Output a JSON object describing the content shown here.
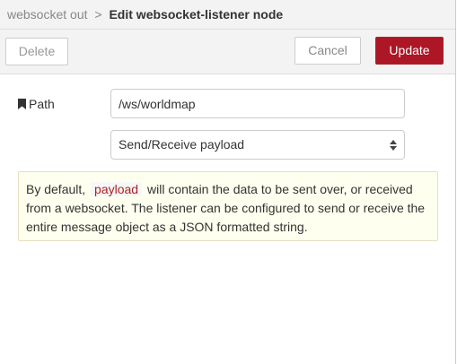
{
  "header": {
    "breadcrumb": "websocket out",
    "separator": ">",
    "title": "Edit websocket-listener node"
  },
  "toolbar": {
    "delete_label": "Delete",
    "cancel_label": "Cancel",
    "update_label": "Update"
  },
  "form": {
    "path_label": "Path",
    "path_icon": "bookmark-icon",
    "path_value": "/ws/worldmap",
    "mode_selected": "Send/Receive payload",
    "mode_icon": "select-arrows-icon"
  },
  "tip": {
    "text_before": "By default,",
    "code": "payload",
    "text_after": "will contain the data to be sent over, or received from a websocket. The listener can be configured to send or receive the entire message object as a JSON formatted string."
  },
  "colors": {
    "update_button": "#ad1625",
    "header_bg": "#f3f3f3",
    "tip_bg": "#ffffef",
    "code_text": "#aa2222"
  }
}
